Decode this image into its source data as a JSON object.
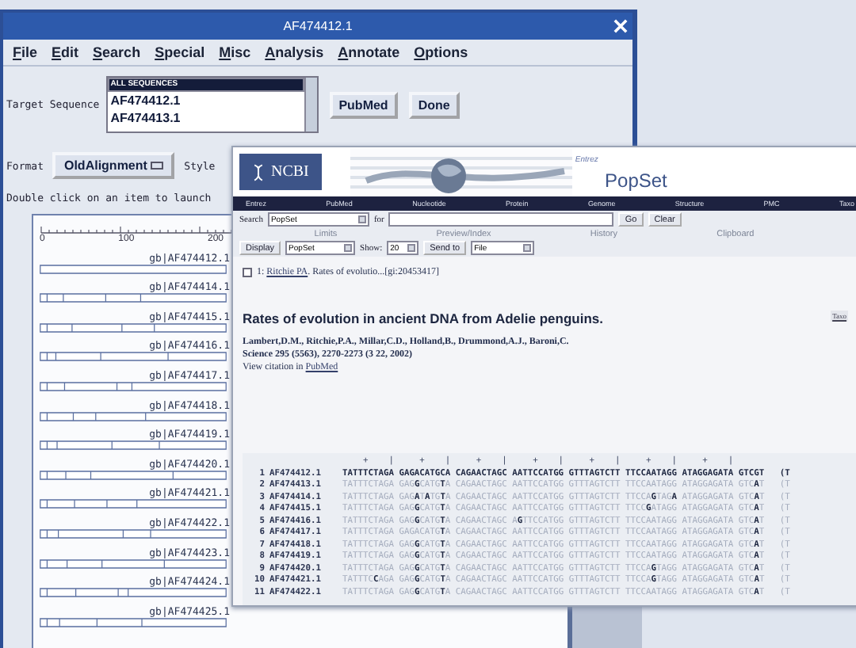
{
  "editor_window": {
    "title": "AF474412.1",
    "menu": [
      "File",
      "Edit",
      "Search",
      "Special",
      "Misc",
      "Analysis",
      "Annotate",
      "Options"
    ],
    "target_label": "Target Sequence",
    "sequence_list": [
      {
        "label": "ALL SEQUENCES",
        "selected": true
      },
      {
        "label": "AF474412.1",
        "selected": false
      },
      {
        "label": "AF474413.1",
        "selected": false
      }
    ],
    "buttons": [
      "PubMed",
      "Done"
    ],
    "format_label": "Format",
    "format_value": "OldAlignment",
    "style_label": "Style",
    "hint": "Double click on an item to launch",
    "ruler_labels": [
      "0",
      "100",
      "200"
    ],
    "tracks": [
      "gb|AF474412.1",
      "gb|AF474414.1",
      "gb|AF474415.1",
      "gb|AF474416.1",
      "gb|AF474417.1",
      "gb|AF474418.1",
      "gb|AF474419.1",
      "gb|AF474420.1",
      "gb|AF474421.1",
      "gb|AF474422.1",
      "gb|AF474423.1",
      "gb|AF474424.1",
      "gb|AF474425.1"
    ]
  },
  "ncbi_window": {
    "logo": "NCBI",
    "banner_small": "Entrez",
    "banner_title": "PopSet",
    "nav": [
      "Entrez",
      "PubMed",
      "Nucleotide",
      "Protein",
      "Genome",
      "Structure",
      "PMC",
      "Taxo"
    ],
    "search": {
      "label": "Search",
      "database": "PopSet",
      "for_label": "for",
      "buttons": [
        "Go",
        "Clear"
      ]
    },
    "tabs": [
      "Limits",
      "Preview/Index",
      "History",
      "Clipboard"
    ],
    "display": {
      "button": "Display",
      "format": "PopSet",
      "show_label": "Show:",
      "show_value": "20",
      "send_button": "Send to",
      "send_value": "File"
    },
    "result": {
      "checked": false,
      "number": "1:",
      "author_link": "Ritchie PA",
      "text": ". Rates of evolutio...[gi:20453417]"
    },
    "side_link": "Taxo",
    "title": "Rates of evolution in ancient DNA from Adelie penguins.",
    "authors": "Lambert,D.M., Ritchie,P.A., Millar,C.D., Holland,B., Drummond,A.J., Baroni,C.",
    "journal": "Science 295 (5563), 2270-2273 (3 22, 2002)",
    "citation": {
      "text": "View citation in",
      "link": "PubMed"
    },
    "alignment": {
      "ruler": "    +    |     +    |     +    |     +    |     +    |     +    |     +    |",
      "rows": [
        {
          "number": "1",
          "accession": "AF474412.1",
          "reference": true,
          "sequence": "TATTTCTAGA GAGACATGCA CAGAACTAGC AATTCCATGG GTTTAGTCTT TTCCAATAGG ATAGGAGATA GTCGT   (T"
        },
        {
          "number": "2",
          "accession": "AF474413.1",
          "reference": false,
          "sequence": "TATTTCTAGA GAG**G**CATG**T**A CAGAACTAGC AATTCCATGG GTTTAGTCTT TTCCAATAGG ATAGGAGATA GTC**A**T   (T"
        },
        {
          "number": "3",
          "accession": "AF474414.1",
          "reference": false,
          "sequence": "TATTTCTAGA GAG**A**T**A**TG**T**A CAGAACTAGC AATTCCATGG GTTTAGTCTT TTCCA**G**TAG**A** ATAGGAGATA GTC**A**T   (T"
        },
        {
          "number": "4",
          "accession": "AF474415.1",
          "reference": false,
          "sequence": "TATTTCTAGA GAG**G**CATG**T**A CAGAACTAGC AATTCCATGG GTTTAGTCTT TTCC**G**ATAGG ATAGGAGATA GTC**A**T   (T"
        },
        {
          "number": "5",
          "accession": "AF474416.1",
          "reference": false,
          "sequence": "TATTTCTAGA GAG**G**CATG**T**A CAGAACTAGC A**G**TTCCATGG GTTTAGTCTT TTCCAATAGG ATAGGAGATA GTC**A**T   (T"
        },
        {
          "number": "6",
          "accession": "AF474417.1",
          "reference": false,
          "sequence": "TATTTCTAGA GAGACATG**T**A CAGAACTAGC AATTCCATGG GTTTAGTCTT TTCCAATAGG ATAGGAGATA GTC**A**T   (T"
        },
        {
          "number": "7",
          "accession": "AF474418.1",
          "reference": false,
          "sequence": "TATTTCTAGA GAG**G**CATG**T**A CAGAACTAGC AATTCCATGG GTTTAGTCTT TTCCAATAGG ATAGGAGATA GTC**A**T   (T"
        },
        {
          "number": "8",
          "accession": "AF474419.1",
          "reference": false,
          "sequence": "TATTTCTAGA GAG**G**CATG**T**A CAGAACTAGC AATTCCATGG GTTTAGTCTT TTCCAATAGG ATAGGAGATA GTC**A**T   (T"
        },
        {
          "number": "9",
          "accession": "AF474420.1",
          "reference": false,
          "sequence": "TATTTCTAGA GAG**G**CATG**T**A CAGAACTAGC AATTCCATGG GTTTAGTCTT TTCCA**G**TAGG ATAGGAGATA GTC**A**T   (T"
        },
        {
          "number": "10",
          "accession": "AF474421.1",
          "reference": false,
          "sequence": "TATTTC**C**AGA GAG**G**CATG**T**A CAGAACTAGC AATTCCATGG GTTTAGTCTT TTCCA**G**TAGG ATAGGAGATA GTC**A**T   (T"
        },
        {
          "number": "11",
          "accession": "AF474422.1",
          "reference": false,
          "sequence": "TATTTCTAGA GAG**G**CATG**T**A CAGAACTAGC AATTCCATGG GTTTAGTCTT TTCCAATAGG ATAGGAGATA GTC**A**T   (T"
        }
      ]
    }
  }
}
